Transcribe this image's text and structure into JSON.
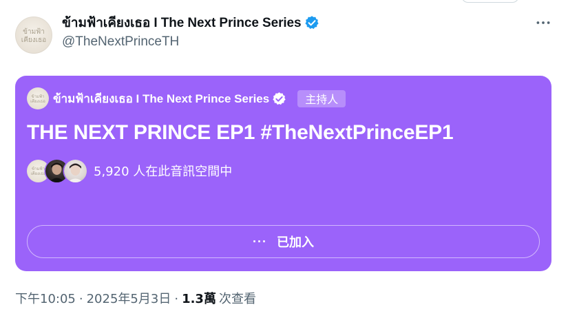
{
  "author": {
    "display_name": "ข้ามฟ้าเคียงเธอ I The Next Prince Series",
    "handle": "@TheNextPrinceTH",
    "avatar_text": [
      "ข้ามฟ้า",
      "เคียงเธอ"
    ],
    "verified": true
  },
  "space": {
    "host_name": "ข้ามฟ้าเคียงเธอ I The Next Prince Series",
    "host_badge": "主持人",
    "title": "THE NEXT PRINCE EP1 #TheNextPrinceEP1",
    "listener_count": "5,920 人在此音訊空間中",
    "joined_label": "已加入",
    "more_dots": "···",
    "accent_color": "#9b63fa"
  },
  "meta": {
    "time": "下午10:05",
    "date": "2025年5月3日",
    "views_count": "1.3萬",
    "views_label": "次查看",
    "separator": "·"
  },
  "icons": {
    "verified": "verified-badge-icon",
    "more": "more-dots-icon"
  },
  "colors": {
    "verified_blue": "#1d9bf0",
    "secondary_text": "#536471",
    "primary_text": "#0f1419"
  }
}
